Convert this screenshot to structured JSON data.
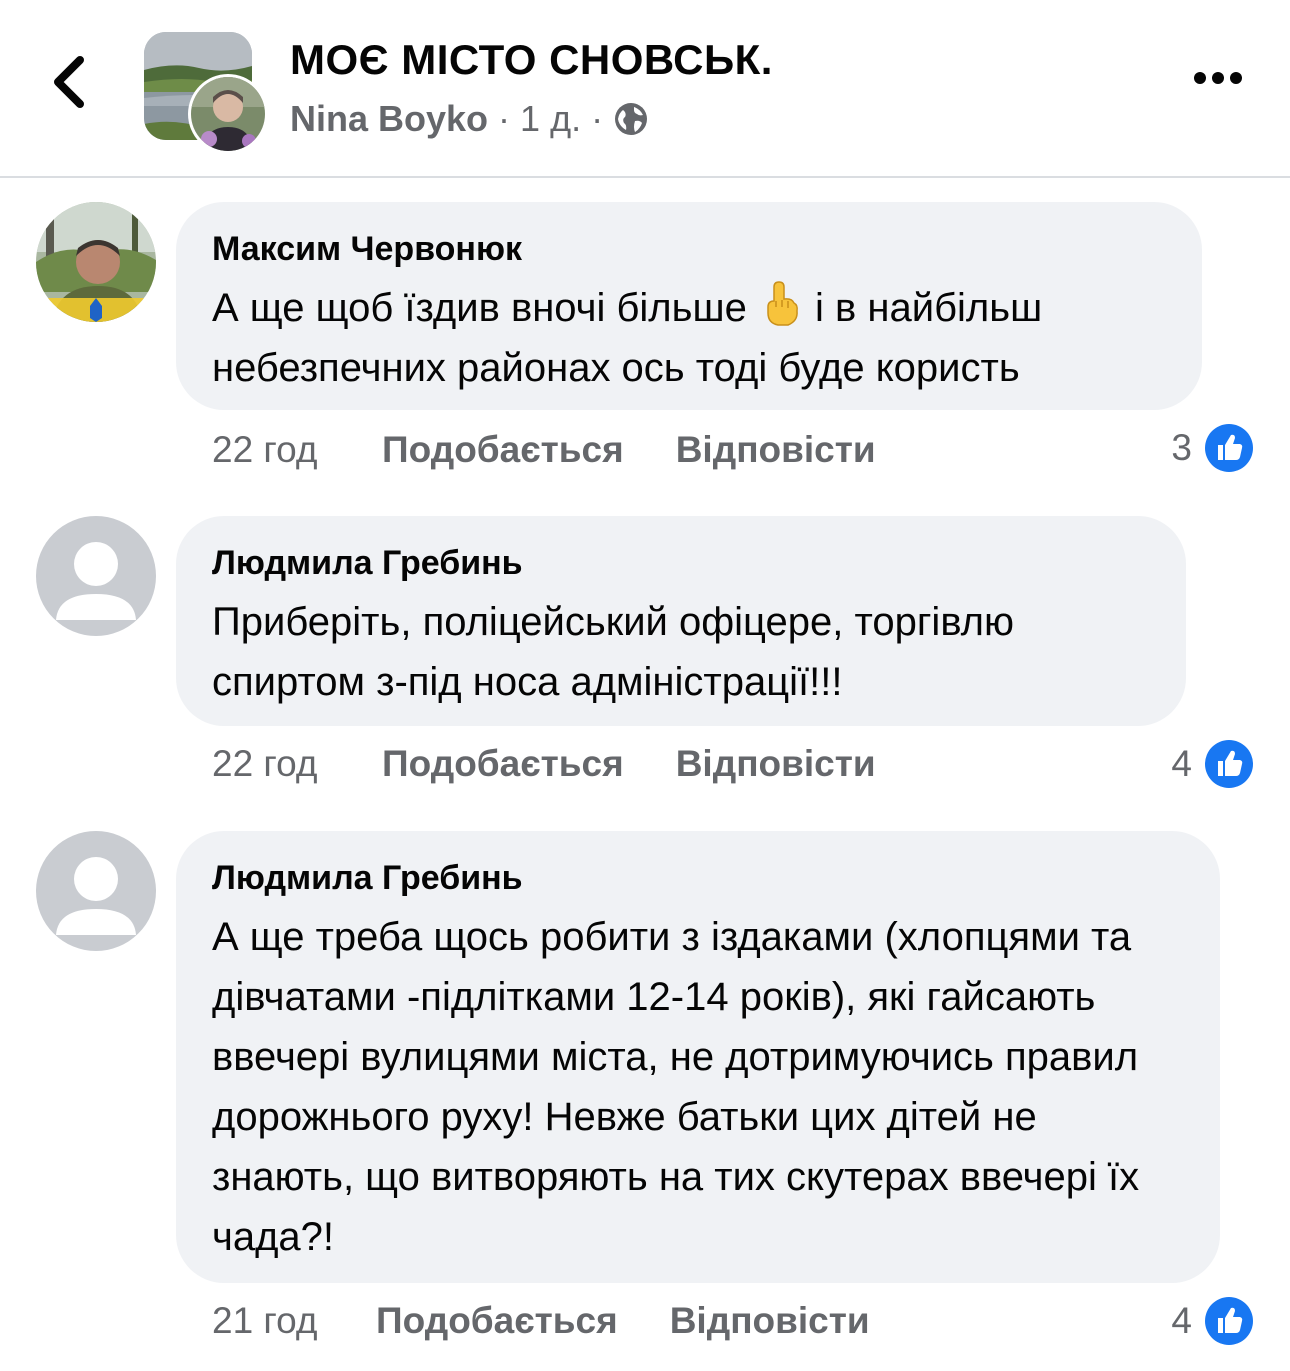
{
  "header": {
    "group_title": "МОЄ МІСТО СНОВСЬК.",
    "author_name": "Nina Boyko",
    "separator": "·",
    "time": "1 д.",
    "back_icon": "chevron-left-icon",
    "audience_icon": "globe-icon",
    "more_icon": "more-horizontal-icon"
  },
  "colors": {
    "bubble_bg": "#f0f2f5",
    "secondary_text": "#65676b",
    "primary_text": "#050505",
    "like_blue": "#1877f2"
  },
  "comments": [
    {
      "author": "Максим Червонюк",
      "text_before_emoji": "А ще щоб їздив вночі більше ",
      "emoji": "☝",
      "text_after_emoji": " і в найбільш небезпечних районах ось тоді буде користь",
      "time": "22 год",
      "like_label": "Подобається",
      "reply_label": "Відповісти",
      "reaction_count": "3"
    },
    {
      "author": "Людмила Гребинь",
      "text": "Приберіть, поліцейський офіцере, торгівлю спиртом з-під носа адміністрації!!!",
      "time": "22 год",
      "like_label": "Подобається",
      "reply_label": "Відповісти",
      "reaction_count": "4"
    },
    {
      "author": "Людмила Гребинь",
      "text": "А ще треба щось робити з іздаками (хлопцями та дівчатами -підлітками 12-14 років), які гайсають  ввечері вулицями міста, не дотримуючись правил дорожнього руху! Невже батьки цих дітей не знають, що витворяють на тих скутерах ввечері їх чада?!",
      "time": "21 год",
      "like_label": "Подобається",
      "reply_label": "Відповісти",
      "reaction_count": "4"
    }
  ]
}
